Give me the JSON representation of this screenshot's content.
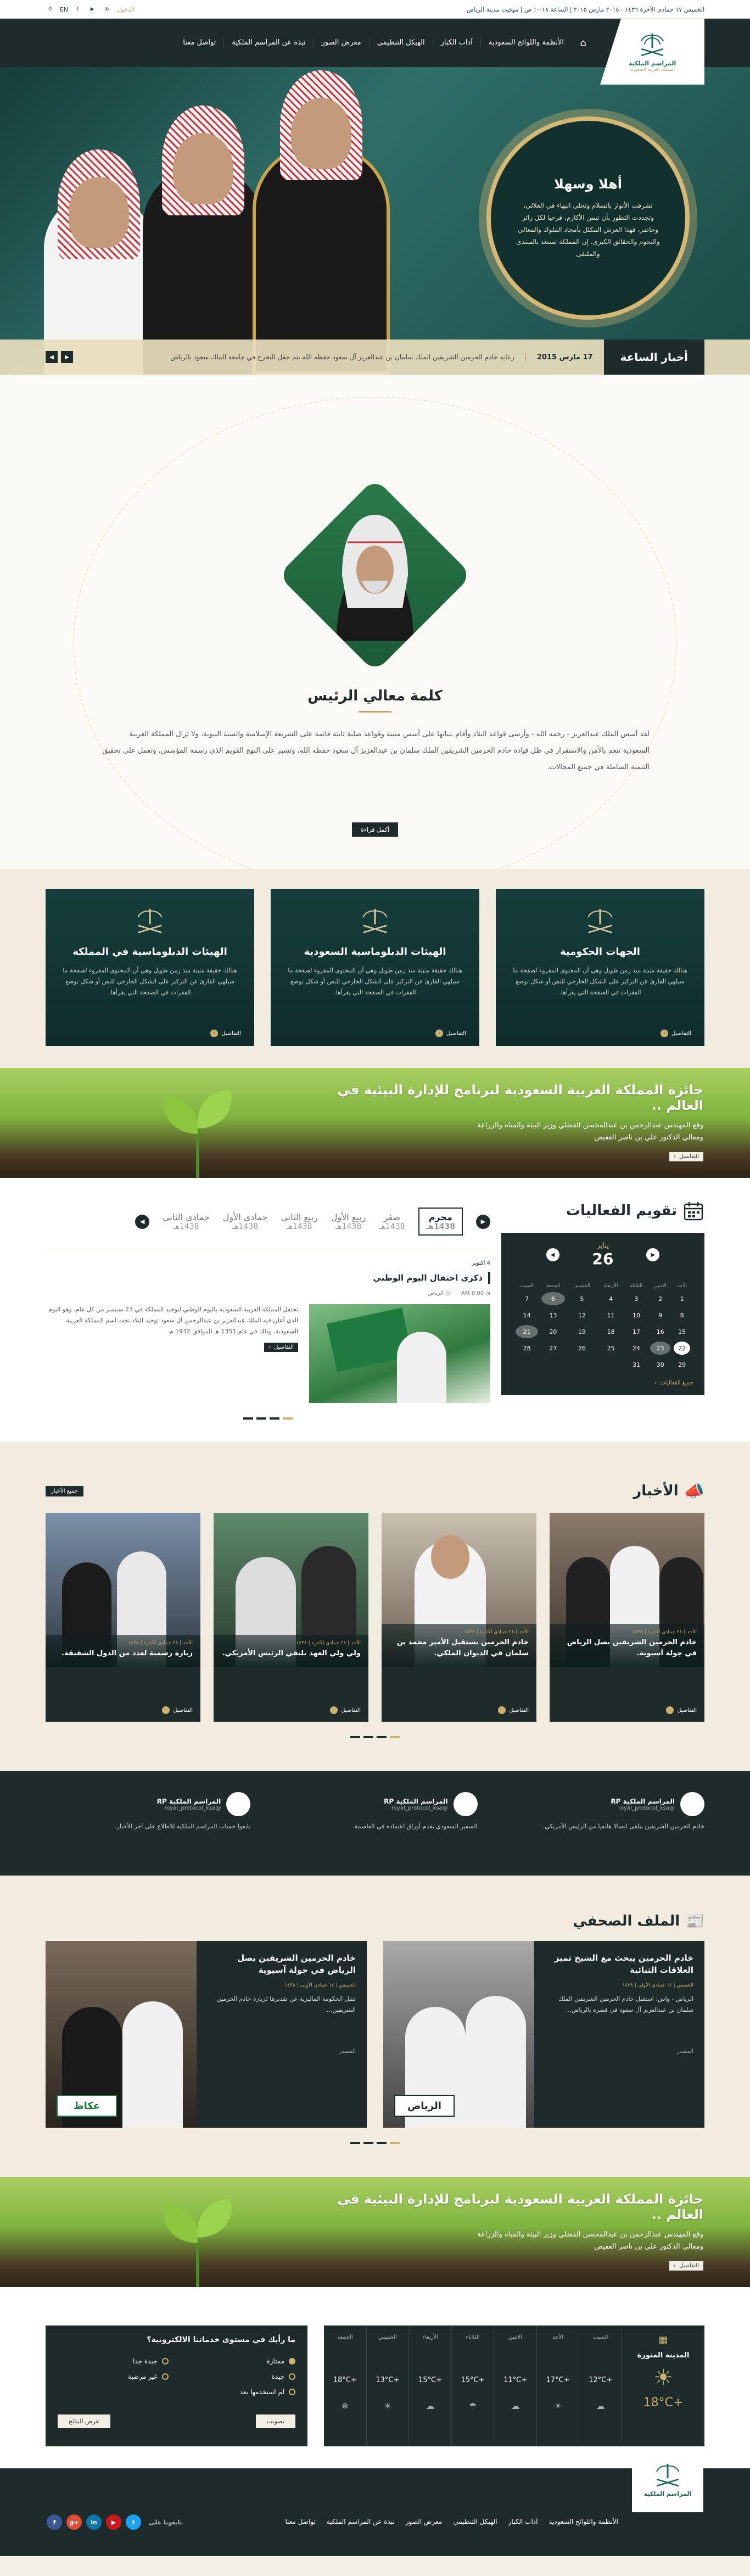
{
  "topbar": {
    "lang": "EN",
    "right_text": "الخميس ١٧ جمادى الآخرة ١٤٣٦ - ٢٠١٥ مارس ٢٠١٥ | الساعة ١٠:١٨ ص | موقيت مدينة الرياض",
    "login": "الدخول"
  },
  "logo": {
    "title": "المراسم الملكية",
    "subtitle": "المملكة العربية السعودية"
  },
  "nav": {
    "items": [
      "الأنظمة واللوائح السعودية",
      "آداب الكبار",
      "الهيكل التنظيمي",
      "معرض الصور",
      "نبذة عن المراسم الملكية",
      "تواصل معنا"
    ]
  },
  "hero": {
    "welcome_title": "أهلا وسهلا",
    "welcome_text": "تشرفت الأنوار بالسلام وتحلى البهاء في العلالي، وتجددت التطور بأن تيمن الأكارم، فرحبا لكل زائر وحاضر، فهذا العرش المكلل بأمجاد الملوك والمعالي والنجوم والحقائق الكبرى. إن المملكة تستعد بالمنتدى والملتقى",
    "ticker_label": "أخبار الساعة",
    "ticker_date": "17 مارس 2015",
    "ticker_text": "رعاية خادم الحرمين الشريفين الملك سلمان بن عبدالعزيز آل سعود حفظه الله يتم حفل التخرج في جامعة الملك سعود بالرياض"
  },
  "president": {
    "title": "كلمة معالي الرئيس",
    "text": "لقد أسس الملك عبدالعزيز - رحمه الله - وأرسى قواعد البلاد وأقام بنيانها على أسس متينة وقواعد صلبة ثابتة قائمة على الشريعة الإسلامية والسنة النبوية، ولا تزال المملكة العربية السعودية تنعم بالأمن والاستقرار في ظل قيادة خادم الحرمين الشريفين الملك سلمان بن عبدالعزيز آل سعود حفظه الله، وتسير على النهج القويم الذي رسمه المؤسس، وتعمل على تحقيق التنمية الشاملة في جميع المجالات.",
    "more_label": "أكمل قراءة"
  },
  "entities": [
    {
      "title": "الجهات الحكومية",
      "text": "هنالك حقيقة مثبتة منذ زمن طويل وهي أن المحتوى المقروء لصفحة ما سيلهي القارئ عن التركيز على الشكل الخارجي للنص أو شكل توضع الفقرات في الصفحة التي يقرأها.",
      "details": "التفاصيل"
    },
    {
      "title": "الهيئات الدبلوماسية السعودية",
      "text": "هنالك حقيقة مثبتة منذ زمن طويل وهي أن المحتوى المقروء لصفحة ما سيلهي القارئ عن التركيز على الشكل الخارجي للنص أو شكل توضع الفقرات في الصفحة التي يقرأها.",
      "details": "التفاصيل"
    },
    {
      "title": "الهيئات الدبلوماسية في المملكة",
      "text": "هنالك حقيقة مثبتة منذ زمن طويل وهي أن المحتوى المقروء لصفحة ما سيلهي القارئ عن التركيز على الشكل الخارجي للنص أو شكل توضع الفقرات في الصفحة التي يقرأها.",
      "details": "التفاصيل"
    }
  ],
  "award": {
    "title": "جائزة المملكة العربية السعودية لبرنامج للإدارة البيئية في العالم ..",
    "line1": "وقع المهندس عبدالرحمن بن عبدالمحسن الفضلي وزير البيئة والمياه والزراعة",
    "line2": "ومعالي الدكتور علي بن ناصر الغفيص",
    "details": "التفاصيل"
  },
  "events": {
    "title": "تقويم الفعاليات",
    "cal_month": "يناير",
    "cal_day": "26",
    "weekdays": [
      "الأحد",
      "الاثنين",
      "الثلاثاء",
      "الأربعاء",
      "الخميس",
      "الجمعة",
      "السبت"
    ],
    "all_events": "جميع الفعاليات",
    "months": [
      {
        "name": "محرم",
        "year": "1438هـ"
      },
      {
        "name": "صفر",
        "year": "1438هـ"
      },
      {
        "name": "ربيع الأول",
        "year": "1438هـ"
      },
      {
        "name": "ربيع الثاني",
        "year": "1438هـ"
      },
      {
        "name": "جمادى الأول",
        "year": "1438هـ"
      },
      {
        "name": "جمادى الثاني",
        "year": "1438هـ"
      }
    ],
    "item_date": "4 اكتوبر",
    "item_title": "ذكرى احتفال اليوم الوطني",
    "item_time": "8:00 AM",
    "item_place": "الرياض",
    "item_text": "تحتفل المملكة العربية السعودية باليوم الوطني لتوحيد المملكة في 23 سبتمبر من كل عام، وهو اليوم الذي أعلن فيه الملك عبدالعزيز بن عبدالرحمن آل سعود توحيد البلاد تحت اسم المملكة العربية السعودية، وذلك في عام 1351 هـ الموافق 1932 م.",
    "item_details": "التفاصيل"
  },
  "news": {
    "title": "الأخبار",
    "all_label": "جميع الأخبار",
    "items": [
      {
        "date": "الأحد | ٢٨ جمادى الآخرة | ١٤٣٨",
        "title": "خادم الحرمين الشريفين يصل الرياض في جولة آسيوية.",
        "details": "التفاصيل"
      },
      {
        "date": "الأحد | ٢٨ جمادى الآخرة | ١٤٣٨",
        "title": "خادم الحرمين يستقبل الأمير محمد بن سلمان في الديوان الملكي.",
        "details": "التفاصيل"
      },
      {
        "date": "الأحد | ٢٨ جمادى الآخرة | ١٤٣٨",
        "title": "ولي ولي العهد يلتقي الرئيس الأمريكي.",
        "details": "التفاصيل"
      },
      {
        "date": "الأحد | ٢٨ جمادى الآخرة | ١٤٣٨",
        "title": "زيارة رسمية لعدد من الدول الشقيقة.",
        "details": "التفاصيل"
      }
    ]
  },
  "protocol": [
    {
      "name": "المراسم الملكية RP",
      "handle": "@royal_protocol_ksa",
      "text": "خادم الحرمين الشريفين يتلقى اتصالا هاتفيا من الرئيس الأمريكي."
    },
    {
      "name": "المراسم الملكية RP",
      "handle": "@royal_protocol_ksa",
      "text": "السفير السعودي يقدم أوراق اعتماده في العاصمة."
    },
    {
      "name": "المراسم الملكية RP",
      "handle": "@royal_protocol_ksa",
      "text": "تابعوا حساب المراسم الملكية للاطلاع على آخر الأخبار."
    }
  ],
  "press": {
    "title": "الملف الصحفي",
    "items": [
      {
        "title": "خادم الحرمين يبحث مع الشيخ تميز العلاقات الثنائية",
        "date": "الخميس | ١٤ جمادى الأولى | ١٤٣٨",
        "text": "الرياض - واس: استقبل خادم الحرمين الشريفين الملك سلمان بن عبدالعزيز آل سعود في قصره بالرياض...",
        "source": "المصدر",
        "paper": "الرياض"
      },
      {
        "title": "خادم الحرمين الشريفين يصل الرياض في جولة آسيوية",
        "date": "الخميس | ١٤ جمادى الأولى | ١٤٣٨",
        "text": "تنقل الحكومة الماليزية عن تقديرها لزيارة خادم الحرمين الشريفين...",
        "source": "المصدر",
        "paper": "عكاظ"
      }
    ]
  },
  "weather": {
    "city": "المدينة المنورة",
    "today_temp": "+18°C",
    "days": [
      {
        "name": "السبت",
        "temp": "+12°C"
      },
      {
        "name": "الأحد",
        "temp": "+17°C"
      },
      {
        "name": "الاثنين",
        "temp": "+11°C"
      },
      {
        "name": "الثلاثاء",
        "temp": "+15°C"
      },
      {
        "name": "الأربعاء",
        "temp": "+15°C"
      },
      {
        "name": "الخميس",
        "temp": "+13°C"
      },
      {
        "name": "الجمعة",
        "temp": "+18°C"
      }
    ]
  },
  "poll": {
    "question": "ما رأيك في مستوى خدماتنا الالكترونية؟",
    "options": [
      "ممتازة",
      "جيدة جدا",
      "جيدة",
      "غير مرضية",
      "لم استخدمها بعد"
    ],
    "vote": "تصويت",
    "results": "عرض النتائج"
  },
  "footer": {
    "menu": [
      "الأنظمة واللوائح السعودية",
      "آداب الكبار",
      "الهيكل التنظيمي",
      "معرض الصور",
      "نبذة عن المراسم الملكية",
      "تواصل معنا"
    ],
    "social_label": "تابعونا على"
  }
}
